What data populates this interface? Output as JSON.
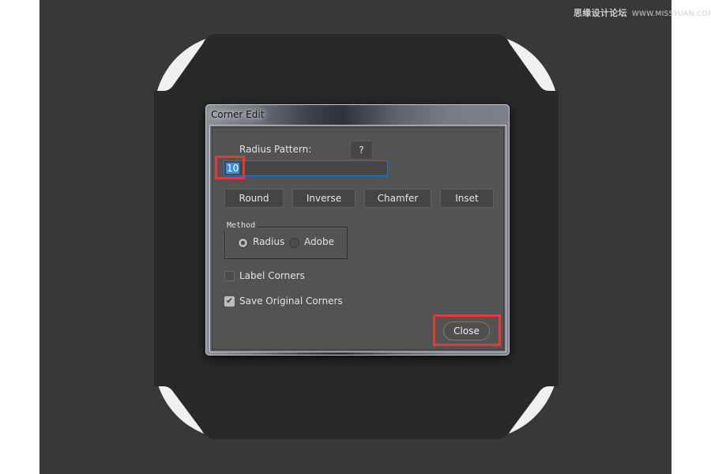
{
  "watermark": {
    "site_name": "思缘设计论坛",
    "url": "WWW.MISSYUAN.COM"
  },
  "dialog": {
    "title": "Corner Edit",
    "radius_pattern_label": "Radius Pattern:",
    "help_button": "?",
    "radius_input_value": "10",
    "buttons": {
      "round": "Round",
      "inverse": "Inverse",
      "chamfer": "Chamfer",
      "inset": "Inset"
    },
    "method": {
      "legend": "Method",
      "options": [
        {
          "label": "Radius",
          "selected": true
        },
        {
          "label": "Adobe",
          "selected": false
        }
      ]
    },
    "checkboxes": [
      {
        "label": "Label Corners",
        "checked": false
      },
      {
        "label": "Save Original Corners",
        "checked": true
      }
    ],
    "close_button": "Close",
    "highlight_color": "#e53935",
    "focus_color": "#1f74d4"
  },
  "icons": {
    "checkmark": "✔"
  }
}
